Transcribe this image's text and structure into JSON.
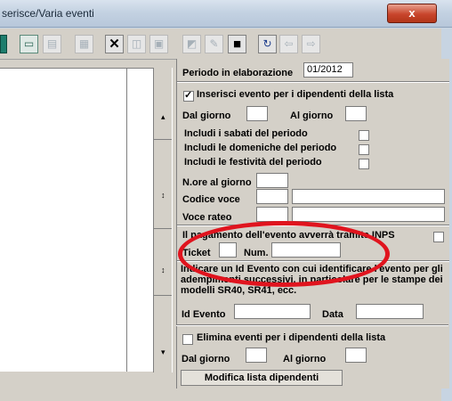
{
  "window": {
    "title": "serisce/Varia eventi",
    "close_label": "x"
  },
  "toolbar": {
    "buttons": [
      {
        "name": "save-green-icon",
        "glyph": ""
      },
      {
        "name": "monitor-icon",
        "glyph": "▭"
      },
      {
        "name": "copy-icon",
        "glyph": "▤"
      },
      {
        "name": "grid-icon",
        "glyph": "▦"
      },
      {
        "name": "delete-icon",
        "glyph": "✕"
      },
      {
        "name": "preview-icon",
        "glyph": "◫"
      },
      {
        "name": "print-icon",
        "glyph": "▣"
      },
      {
        "name": "chart-icon",
        "glyph": "◩"
      },
      {
        "name": "edit-icon",
        "glyph": "✎"
      },
      {
        "name": "disk-icon",
        "glyph": "■"
      },
      {
        "name": "refresh-icon",
        "glyph": "↻"
      },
      {
        "name": "back-icon",
        "glyph": "⇦"
      },
      {
        "name": "forward-icon",
        "glyph": "⇨"
      }
    ]
  },
  "form": {
    "periodo_label": "Periodo in elaborazione",
    "periodo_value": "01/2012",
    "inserisci_label": "Inserisci evento per i dipendenti della lista",
    "inserisci_checked": true,
    "dal_giorno_label": "Dal giorno",
    "al_giorno_label": "Al giorno",
    "includi_sabati": "Includi i sabati del periodo",
    "includi_domeniche": "Includi le domeniche del periodo",
    "includi_festivita": "Includi le festività del periodo",
    "nore_label": "N.ore al giorno",
    "codice_voce_label": "Codice voce",
    "voce_rateo_label": "Voce rateo",
    "pagamento_label": "Il pagamento dell'evento avverrà tramite INPS",
    "ticket_label": "Ticket",
    "num_label": "Num.",
    "note": "Indicare un Id Evento con cui identificare l'evento per gli adempimenti successivi, in particolare per le stampe dei modelli SR40, SR41, ecc.",
    "id_evento_label": "Id Evento",
    "data_label": "Data",
    "elimina_label": "Elimina eventi per i dipendenti della lista",
    "dal_giorno2_label": "Dal giorno",
    "al_giorno2_label": "Al giorno",
    "modifica_button": "Modifica lista dipendenti"
  },
  "colors": {
    "window_bg": "#d4d0c8",
    "highlight": "#e0141e",
    "title_bar": "#c4d2e2"
  }
}
